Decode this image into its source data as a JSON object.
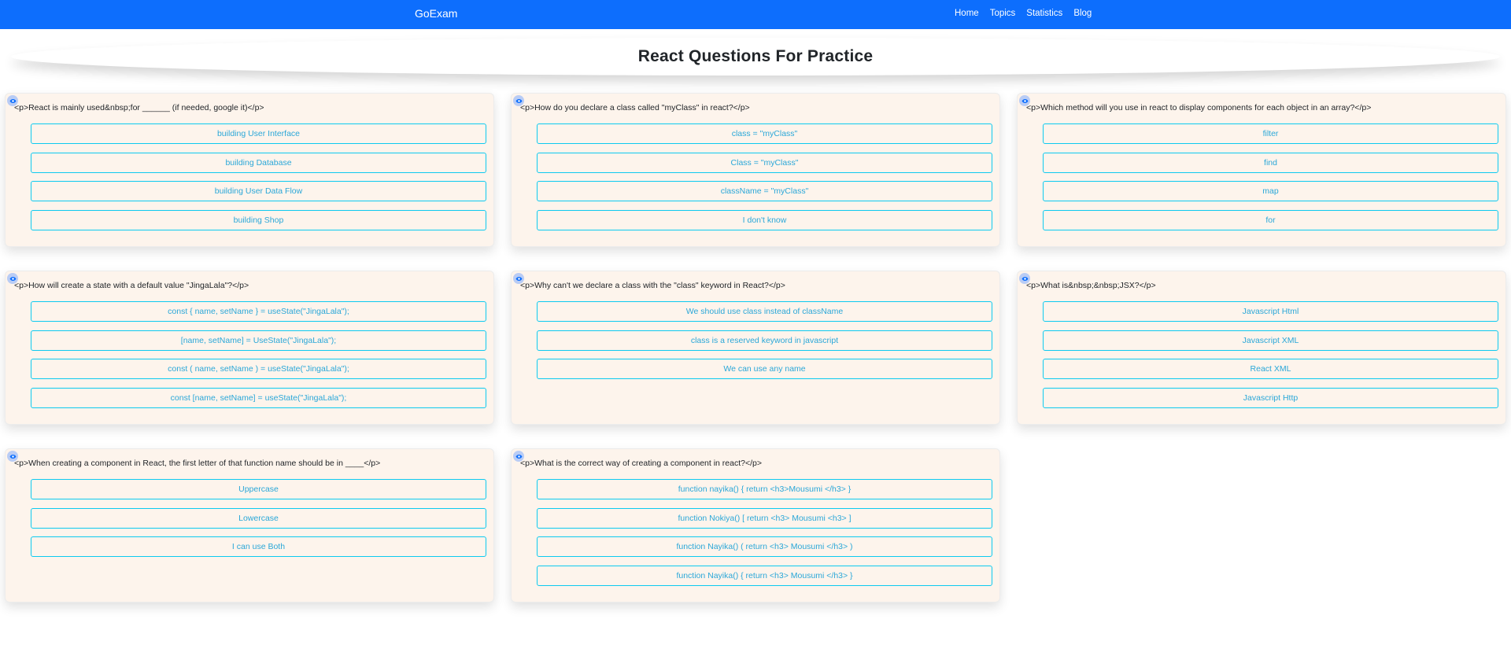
{
  "navbar": {
    "brand": "GoExam",
    "links": [
      "Home",
      "Topics",
      "Statistics",
      "Blog"
    ]
  },
  "page": {
    "title": "React Questions For Practice"
  },
  "colors": {
    "navbar": "#0d6efd",
    "card_bg": "#fdf4ec",
    "option_border": "#0dcaf0",
    "option_text": "#2aa7d8"
  },
  "icons": {
    "reveal_answer": "eye-icon"
  },
  "questions": [
    {
      "question": "<p>React is mainly used&nbsp;for ______ (if needed, google it)</p>",
      "options": [
        "building User Interface",
        "building Database",
        "building User Data Flow",
        "building Shop"
      ]
    },
    {
      "question": "<p>How do you declare a class called \"myClass\" in react?</p>",
      "options": [
        "class = \"myClass\"",
        "Class = \"myClass\"",
        "className = \"myClass\"",
        "I don't know"
      ]
    },
    {
      "question": "<p>Which method will you use in react to display components for each object in an array?</p>",
      "options": [
        "filter",
        "find",
        "map",
        "for"
      ]
    },
    {
      "question": "<p>How will create a state with a default value \"JingaLala\"?</p>",
      "options": [
        "const { name, setName } = useState(\"JingaLala\");",
        "[name, setName] = UseState(\"JingaLala\");",
        "const ( name, setName ) = useState(\"JingaLala\");",
        "const [name, setName] = useState(\"JingaLala\");"
      ]
    },
    {
      "question": "<p>Why can't we declare a class with the \"class\" keyword in React?</p>",
      "options": [
        "We should use class instead of className",
        "class is a reserved keyword in javascript",
        "We can use any name"
      ]
    },
    {
      "question": "<p>What is&nbsp;&nbsp;JSX?</p>",
      "options": [
        "Javascript Html",
        "Javascript XML",
        "React XML",
        "Javascript Http"
      ]
    },
    {
      "question": "<p>When creating a component in React, the first letter of that function name should be in ____</p>",
      "options": [
        "Uppercase",
        "Lowercase",
        "I can use Both"
      ]
    },
    {
      "question": "<p>What is the correct way of creating a component in react?</p>",
      "options": [
        "function nayika() { return <h3>Mousumi </h3> }",
        "function Nokiya() [ return <h3> Mousumi <h3> ]",
        "function Nayika() ( return <h3> Mousumi </h3> )",
        "function Nayika() { return <h3> Mousumi </h3> }"
      ]
    }
  ]
}
